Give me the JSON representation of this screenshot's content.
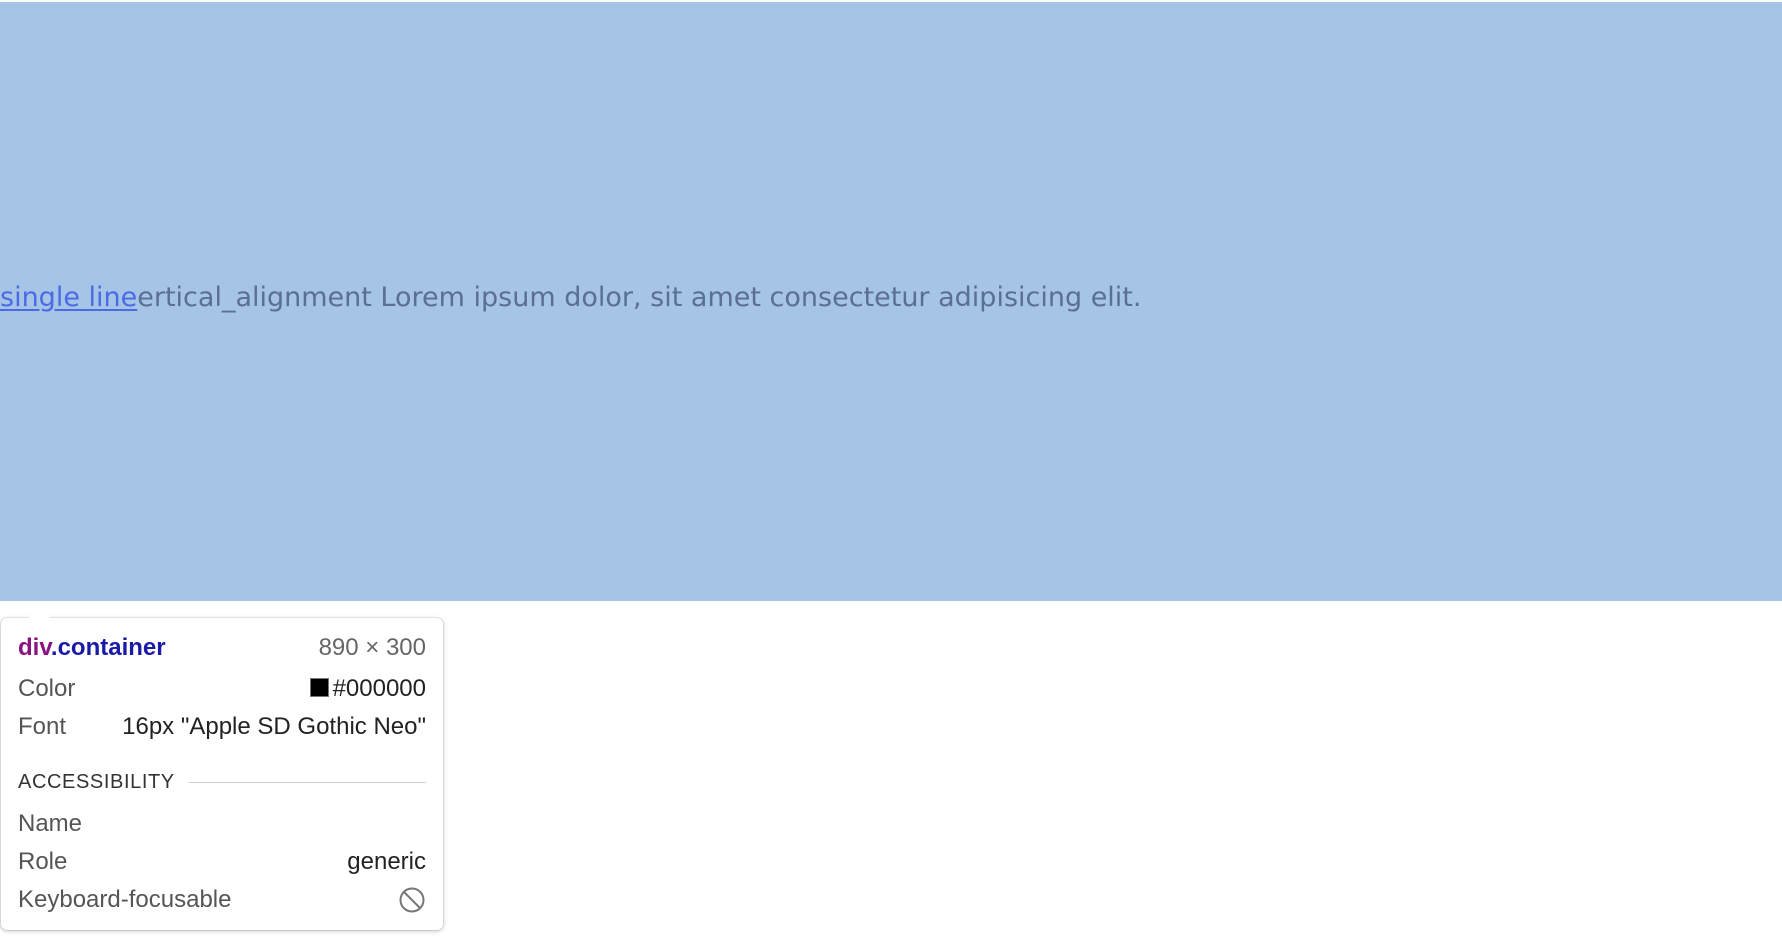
{
  "content": {
    "link_text": "single line",
    "rest_text": "ertical_alignment Lorem ipsum dolor, sit amet consectetur adipisicing elit."
  },
  "tooltip": {
    "element_tag": "div",
    "element_class": ".container",
    "dimensions": "890 × 300",
    "color_label": "Color",
    "color_value": "#000000",
    "font_label": "Font",
    "font_value": "16px \"Apple SD Gothic Neo\"",
    "section_title": "ACCESSIBILITY",
    "name_label": "Name",
    "name_value": "",
    "role_label": "Role",
    "role_value": "generic",
    "focusable_label": "Keyboard-focusable",
    "focusable_icon": "not-allowed-icon"
  },
  "colors": {
    "highlight": "#a6c4e6",
    "link": "#4b6ae6",
    "text": "#5a6f93",
    "tag": "#881280",
    "class": "#1a1aa6"
  }
}
